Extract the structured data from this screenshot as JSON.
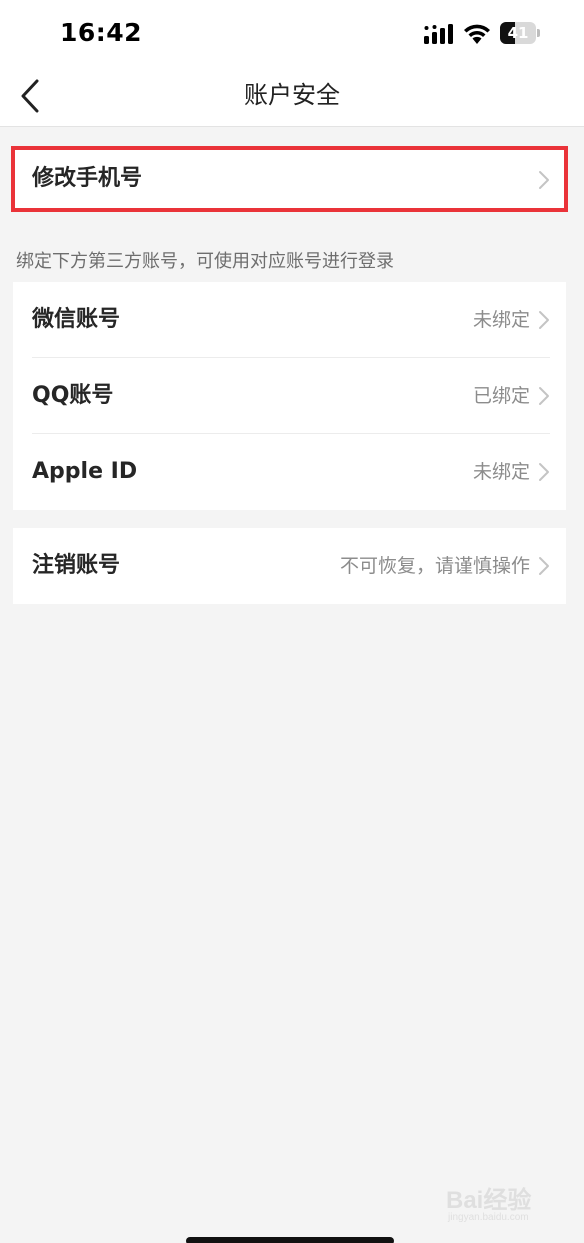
{
  "status_bar": {
    "time": "16:42",
    "battery_level": "41",
    "battery_fraction": 0.41,
    "icons": [
      "signal-icon",
      "wifi-icon",
      "battery-icon"
    ]
  },
  "nav": {
    "title": "账户安全",
    "back_icon": "chevron-left-icon"
  },
  "phone_section": {
    "label": "修改手机号",
    "highlight_color": "#ea3339"
  },
  "third_party": {
    "caption": "绑定下方第三方账号，可使用对应账号进行登录",
    "items": [
      {
        "label": "微信账号",
        "value": "未绑定"
      },
      {
        "label": "QQ账号",
        "value": "已绑定"
      },
      {
        "label": "Apple ID",
        "value": "未绑定"
      }
    ]
  },
  "deactivate": {
    "label": "注销账号",
    "value": "不可恢复，请谨慎操作"
  },
  "watermark": {
    "brand": "Bai经验",
    "url": "jingyan.baidu.com"
  },
  "colors": {
    "background": "#f4f4f4",
    "card": "#ffffff",
    "accent_red": "#ea3339",
    "muted_text": "#8c8c8c"
  }
}
